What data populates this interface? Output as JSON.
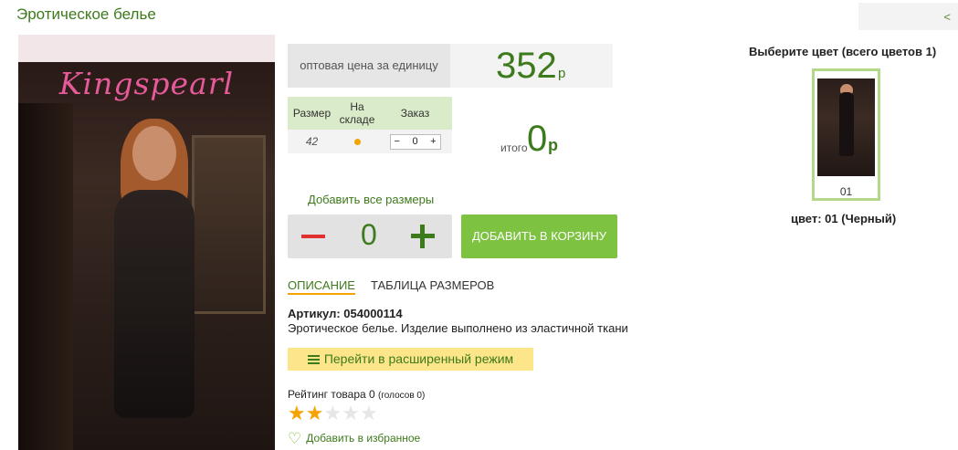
{
  "page": {
    "title": "Эротическое белье",
    "nav_back": "<"
  },
  "product": {
    "image_brand": "Kingspearl",
    "price_label": "оптовая цена за единицу",
    "price": "352",
    "price_currency": "р",
    "size_table": {
      "headers": [
        "Размер",
        "На складе",
        "Заказ"
      ],
      "rows": [
        {
          "size": "42",
          "in_stock": true,
          "order_minus": "−",
          "order_qty": "0",
          "order_plus": "+"
        }
      ]
    },
    "total_label": "итого",
    "total_value": "0",
    "total_currency": "р",
    "add_all_sizes": "Добавить все размеры",
    "quantity": "0",
    "add_to_cart": "ДОБАВИТЬ В КОРЗИНУ"
  },
  "tabs": [
    {
      "label": "ОПИСАНИЕ",
      "active": true
    },
    {
      "label": "ТАБЛИЦА РАЗМЕРОВ",
      "active": false
    }
  ],
  "description": {
    "article": "Артикул: 054000114",
    "text": "Эротическое белье. Изделие выполнено из эластичной ткани"
  },
  "advanced_mode": "Перейти в расширенный режим",
  "rating": {
    "label": "Рейтинг товара 0",
    "votes": "(голосов 0)",
    "stars_filled": 2,
    "stars_total": 5
  },
  "favorite": "Добавить в избранное",
  "colors": {
    "title": "Выберите цвет (всего цветов 1)",
    "items": [
      {
        "code": "01"
      }
    ],
    "selected": "цвет: 01 (Черный)"
  },
  "colors_palette": {
    "accent_green": "#3d7a1c",
    "button_green": "#7ec242",
    "star_orange": "#f5a300",
    "minus_red": "#e03030"
  }
}
